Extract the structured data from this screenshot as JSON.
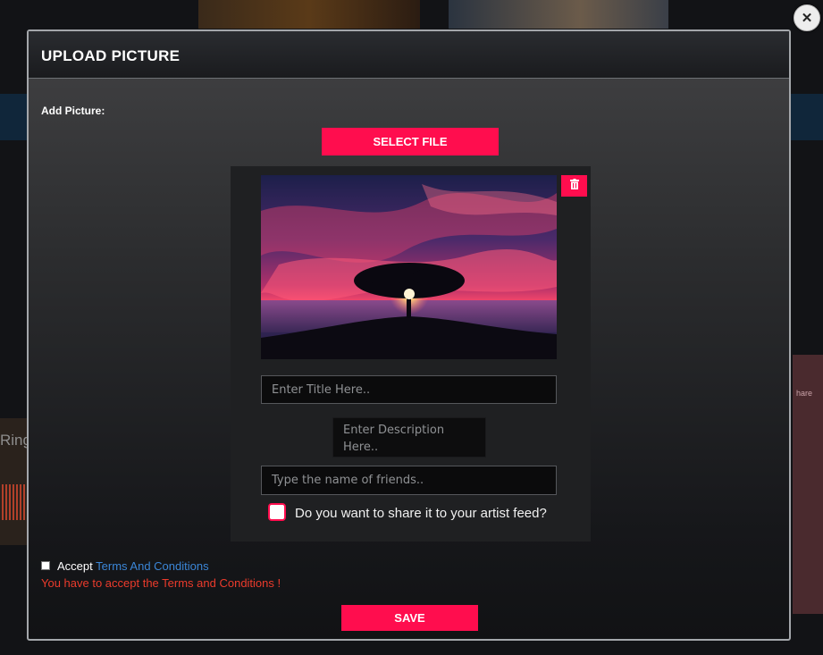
{
  "background": {
    "partial_text": "Ring"
  },
  "dialog": {
    "title": "UPLOAD PICTURE",
    "close_icon": "close-icon",
    "add_picture_label": "Add Picture:",
    "select_file_label": "SELECT FILE",
    "preview": {
      "delete_icon": "trash-icon",
      "title_placeholder": "Enter Title Here..",
      "description_placeholder": "Enter Description Here..",
      "friends_placeholder": "Type the name of friends..",
      "share_question": "Do you want to share it to your artist feed?"
    },
    "terms": {
      "accept_text": "Accept",
      "link_text": "Terms And Conditions",
      "error_text": "You have to accept the Terms and Conditions !"
    },
    "save_label": "SAVE"
  },
  "colors": {
    "accent": "#ff0d4e",
    "link": "#3b86d6",
    "error": "#ec3b2c"
  }
}
